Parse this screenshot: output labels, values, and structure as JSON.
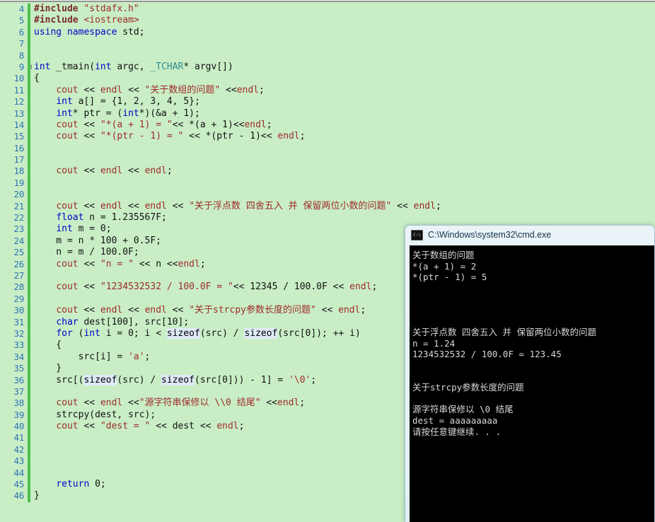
{
  "editor": {
    "name": "visual-studio-code-editor",
    "background_color": "#c9eec6",
    "line_number_color": "#2e74b5",
    "change_bar_color": "#4dc14d",
    "first_line_number": 4,
    "lines": [
      {
        "n": "4",
        "glyph": "",
        "tokens": [
          {
            "t": "#include ",
            "c": "pp"
          },
          {
            "t": "\"stdafx.h\"",
            "c": "str"
          }
        ]
      },
      {
        "n": "5",
        "glyph": "",
        "tokens": [
          {
            "t": "#include ",
            "c": "pp"
          },
          {
            "t": "<iostream>",
            "c": "str"
          }
        ]
      },
      {
        "n": "6",
        "glyph": "",
        "tokens": [
          {
            "t": "using",
            "c": "kw"
          },
          {
            "t": " ",
            "c": "pl"
          },
          {
            "t": "namespace",
            "c": "kw"
          },
          {
            "t": " std;",
            "c": "pl"
          }
        ]
      },
      {
        "n": "7",
        "glyph": "",
        "tokens": []
      },
      {
        "n": "8",
        "glyph": "",
        "tokens": []
      },
      {
        "n": "9",
        "glyph": "-",
        "tokens": [
          {
            "t": "int",
            "c": "kw"
          },
          {
            "t": " _tmain(",
            "c": "pl"
          },
          {
            "t": "int",
            "c": "kw"
          },
          {
            "t": " argc, ",
            "c": "pl"
          },
          {
            "t": "_TCHAR",
            "c": "typ"
          },
          {
            "t": "* argv[])",
            "c": "pl"
          }
        ]
      },
      {
        "n": "10",
        "glyph": "",
        "tokens": [
          {
            "t": "{",
            "c": "pl"
          }
        ]
      },
      {
        "n": "11",
        "glyph": "",
        "tokens": [
          {
            "t": "    ",
            "c": "pl"
          },
          {
            "t": "cout",
            "c": "str"
          },
          {
            "t": " << ",
            "c": "pl"
          },
          {
            "t": "endl",
            "c": "str"
          },
          {
            "t": " << ",
            "c": "pl"
          },
          {
            "t": "\"关于数组的问题\"",
            "c": "str"
          },
          {
            "t": " <<",
            "c": "pl"
          },
          {
            "t": "endl",
            "c": "str"
          },
          {
            "t": ";",
            "c": "pl"
          }
        ]
      },
      {
        "n": "12",
        "glyph": "",
        "tokens": [
          {
            "t": "    ",
            "c": "pl"
          },
          {
            "t": "int",
            "c": "kw"
          },
          {
            "t": " a[] = {1, 2, 3, 4, 5};",
            "c": "pl"
          }
        ]
      },
      {
        "n": "13",
        "glyph": "",
        "tokens": [
          {
            "t": "    ",
            "c": "pl"
          },
          {
            "t": "int",
            "c": "kw"
          },
          {
            "t": "* ptr = (",
            "c": "pl"
          },
          {
            "t": "int",
            "c": "kw"
          },
          {
            "t": "*)(&a + 1);",
            "c": "pl"
          }
        ]
      },
      {
        "n": "14",
        "glyph": "",
        "tokens": [
          {
            "t": "    ",
            "c": "pl"
          },
          {
            "t": "cout",
            "c": "str"
          },
          {
            "t": " << ",
            "c": "pl"
          },
          {
            "t": "\"*(a + 1) = \"",
            "c": "str"
          },
          {
            "t": "<< *(a + 1)<<",
            "c": "pl"
          },
          {
            "t": "endl",
            "c": "str"
          },
          {
            "t": ";",
            "c": "pl"
          }
        ]
      },
      {
        "n": "15",
        "glyph": "",
        "tokens": [
          {
            "t": "    ",
            "c": "pl"
          },
          {
            "t": "cout",
            "c": "str"
          },
          {
            "t": " << ",
            "c": "pl"
          },
          {
            "t": "\"*(ptr - 1) = \"",
            "c": "str"
          },
          {
            "t": " << *(ptr - 1)<< ",
            "c": "pl"
          },
          {
            "t": "endl",
            "c": "str"
          },
          {
            "t": ";",
            "c": "pl"
          }
        ]
      },
      {
        "n": "16",
        "glyph": "",
        "tokens": []
      },
      {
        "n": "17",
        "glyph": "",
        "tokens": []
      },
      {
        "n": "18",
        "glyph": "",
        "tokens": [
          {
            "t": "    ",
            "c": "pl"
          },
          {
            "t": "cout",
            "c": "str"
          },
          {
            "t": " << ",
            "c": "pl"
          },
          {
            "t": "endl",
            "c": "str"
          },
          {
            "t": " << ",
            "c": "pl"
          },
          {
            "t": "endl",
            "c": "str"
          },
          {
            "t": ";",
            "c": "pl"
          }
        ]
      },
      {
        "n": "19",
        "glyph": "",
        "tokens": []
      },
      {
        "n": "20",
        "glyph": "",
        "tokens": []
      },
      {
        "n": "21",
        "glyph": "",
        "tokens": [
          {
            "t": "    ",
            "c": "pl"
          },
          {
            "t": "cout",
            "c": "str"
          },
          {
            "t": " << ",
            "c": "pl"
          },
          {
            "t": "endl",
            "c": "str"
          },
          {
            "t": " << ",
            "c": "pl"
          },
          {
            "t": "endl",
            "c": "str"
          },
          {
            "t": " << ",
            "c": "pl"
          },
          {
            "t": "\"关于浮点数 四舍五入 并 保留两位小数的问题\"",
            "c": "str"
          },
          {
            "t": " << ",
            "c": "pl"
          },
          {
            "t": "endl",
            "c": "str"
          },
          {
            "t": ";",
            "c": "pl"
          }
        ]
      },
      {
        "n": "22",
        "glyph": "",
        "tokens": [
          {
            "t": "    ",
            "c": "pl"
          },
          {
            "t": "float",
            "c": "kw"
          },
          {
            "t": " n = 1.235567F;",
            "c": "pl"
          }
        ]
      },
      {
        "n": "23",
        "glyph": "",
        "tokens": [
          {
            "t": "    ",
            "c": "pl"
          },
          {
            "t": "int",
            "c": "kw"
          },
          {
            "t": " m = 0;",
            "c": "pl"
          }
        ]
      },
      {
        "n": "24",
        "glyph": "",
        "tokens": [
          {
            "t": "    m = n * 100 + 0.5F;",
            "c": "pl"
          }
        ]
      },
      {
        "n": "25",
        "glyph": "",
        "tokens": [
          {
            "t": "    n = m / 100.0F;",
            "c": "pl"
          }
        ]
      },
      {
        "n": "26",
        "glyph": "",
        "tokens": [
          {
            "t": "    ",
            "c": "pl"
          },
          {
            "t": "cout",
            "c": "str"
          },
          {
            "t": " << ",
            "c": "pl"
          },
          {
            "t": "\"n = \"",
            "c": "str"
          },
          {
            "t": " << n <<",
            "c": "pl"
          },
          {
            "t": "endl",
            "c": "str"
          },
          {
            "t": ";",
            "c": "pl"
          }
        ]
      },
      {
        "n": "27",
        "glyph": "",
        "tokens": []
      },
      {
        "n": "28",
        "glyph": "",
        "tokens": [
          {
            "t": "    ",
            "c": "pl"
          },
          {
            "t": "cout",
            "c": "str"
          },
          {
            "t": " << ",
            "c": "pl"
          },
          {
            "t": "\"1234532532 / 100.0F = \"",
            "c": "str"
          },
          {
            "t": "<< 12345 / 100.0F << ",
            "c": "pl"
          },
          {
            "t": "endl",
            "c": "str"
          },
          {
            "t": ";",
            "c": "pl"
          }
        ]
      },
      {
        "n": "29",
        "glyph": "",
        "tokens": []
      },
      {
        "n": "30",
        "glyph": "",
        "tokens": [
          {
            "t": "    ",
            "c": "pl"
          },
          {
            "t": "cout",
            "c": "str"
          },
          {
            "t": " << ",
            "c": "pl"
          },
          {
            "t": "endl",
            "c": "str"
          },
          {
            "t": " << ",
            "c": "pl"
          },
          {
            "t": "endl",
            "c": "str"
          },
          {
            "t": " << ",
            "c": "pl"
          },
          {
            "t": "\"关于strcpy参数长度的问题\"",
            "c": "str"
          },
          {
            "t": " << ",
            "c": "pl"
          },
          {
            "t": "endl",
            "c": "str"
          },
          {
            "t": ";",
            "c": "pl"
          }
        ]
      },
      {
        "n": "31",
        "glyph": "",
        "tokens": [
          {
            "t": "    ",
            "c": "pl"
          },
          {
            "t": "char",
            "c": "kw"
          },
          {
            "t": " dest[100], src[10];",
            "c": "pl"
          }
        ]
      },
      {
        "n": "32",
        "glyph": "",
        "tokens": [
          {
            "t": "    ",
            "c": "pl"
          },
          {
            "t": "for",
            "c": "kw"
          },
          {
            "t": " (",
            "c": "pl"
          },
          {
            "t": "int",
            "c": "kw"
          },
          {
            "t": " i = 0; i < ",
            "c": "pl"
          },
          {
            "t": "sizeof",
            "c": "hl"
          },
          {
            "t": "(src) / ",
            "c": "pl"
          },
          {
            "t": "sizeof",
            "c": "hl"
          },
          {
            "t": "(src[0]); ++ i)",
            "c": "pl"
          }
        ]
      },
      {
        "n": "33",
        "glyph": "",
        "tokens": [
          {
            "t": "    {",
            "c": "pl"
          }
        ]
      },
      {
        "n": "34",
        "glyph": "",
        "tokens": [
          {
            "t": "        src[i] = ",
            "c": "pl"
          },
          {
            "t": "'a'",
            "c": "str"
          },
          {
            "t": ";",
            "c": "pl"
          }
        ]
      },
      {
        "n": "35",
        "glyph": "",
        "tokens": [
          {
            "t": "    }",
            "c": "pl"
          }
        ]
      },
      {
        "n": "36",
        "glyph": "",
        "tokens": [
          {
            "t": "    src[(",
            "c": "pl"
          },
          {
            "t": "sizeof",
            "c": "hl"
          },
          {
            "t": "(src) / ",
            "c": "pl"
          },
          {
            "t": "sizeof",
            "c": "hl"
          },
          {
            "t": "(src[0])) - 1] = ",
            "c": "pl"
          },
          {
            "t": "'\\0'",
            "c": "str"
          },
          {
            "t": ";",
            "c": "pl"
          }
        ]
      },
      {
        "n": "37",
        "glyph": "",
        "tokens": []
      },
      {
        "n": "38",
        "glyph": "",
        "tokens": [
          {
            "t": "    ",
            "c": "pl"
          },
          {
            "t": "cout",
            "c": "str"
          },
          {
            "t": " << ",
            "c": "pl"
          },
          {
            "t": "endl",
            "c": "str"
          },
          {
            "t": " <<",
            "c": "pl"
          },
          {
            "t": "\"源字符串保修以 \\\\0 结尾\"",
            "c": "str"
          },
          {
            "t": " <<",
            "c": "pl"
          },
          {
            "t": "endl",
            "c": "str"
          },
          {
            "t": ";",
            "c": "pl"
          }
        ]
      },
      {
        "n": "39",
        "glyph": "",
        "tokens": [
          {
            "t": "    strcpy(dest, src);",
            "c": "pl"
          }
        ]
      },
      {
        "n": "40",
        "glyph": "",
        "tokens": [
          {
            "t": "    ",
            "c": "pl"
          },
          {
            "t": "cout",
            "c": "str"
          },
          {
            "t": " << ",
            "c": "pl"
          },
          {
            "t": "\"dest = \"",
            "c": "str"
          },
          {
            "t": " << dest << ",
            "c": "pl"
          },
          {
            "t": "endl",
            "c": "str"
          },
          {
            "t": ";",
            "c": "pl"
          }
        ]
      },
      {
        "n": "41",
        "glyph": "",
        "tokens": []
      },
      {
        "n": "42",
        "glyph": "",
        "tokens": []
      },
      {
        "n": "43",
        "glyph": "",
        "tokens": []
      },
      {
        "n": "44",
        "glyph": "",
        "tokens": []
      },
      {
        "n": "45",
        "glyph": "",
        "tokens": [
          {
            "t": "    ",
            "c": "pl"
          },
          {
            "t": "return",
            "c": "kw"
          },
          {
            "t": " 0;",
            "c": "pl"
          }
        ]
      },
      {
        "n": "46",
        "glyph": "",
        "tokens": [
          {
            "t": "}",
            "c": "pl"
          }
        ]
      }
    ]
  },
  "console": {
    "name": "command-prompt-window",
    "title": "C:\\Windows\\system32\\cmd.exe",
    "icon": "cmd-icon",
    "background_color": "#000000",
    "text_color": "#d8d8d8",
    "output_lines": [
      "关于数组的问题",
      "*(a + 1) = 2",
      "*(ptr - 1) = 5",
      "",
      "",
      "",
      "",
      "关于浮点数 四舍五入 并 保留两位小数的问题",
      "n = 1.24",
      "1234532532 / 100.0F = 123.45",
      "",
      "",
      "关于strcpy参数长度的问题",
      "",
      "源字符串保修以 \\0 结尾",
      "dest = aaaaaaaaa",
      "请按任意键继续. . ."
    ]
  }
}
